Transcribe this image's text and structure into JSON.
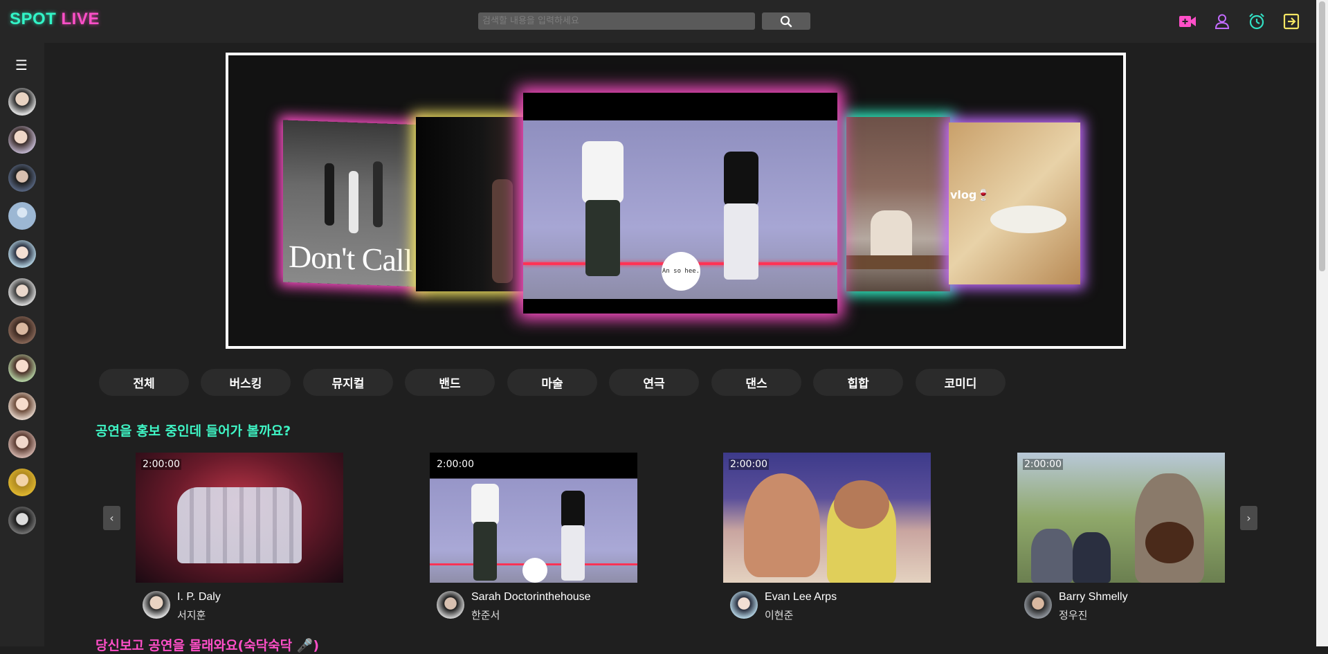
{
  "header": {
    "logo_part1": "SPOT",
    "logo_part2": "LIVE",
    "search_placeholder": "검색할 내용을 입력하세요",
    "icons": [
      "live-camera-icon",
      "user-icon",
      "alarm-clock-icon",
      "logout-icon"
    ],
    "icon_colors": [
      "#ff4fc8",
      "#c46bff",
      "#32e0c4",
      "#f5e663"
    ]
  },
  "sidebar": {
    "menu_icon": "☰",
    "avatars": [
      "avatar-1",
      "avatar-2",
      "avatar-3",
      "avatar-4",
      "avatar-5",
      "avatar-6",
      "avatar-7",
      "avatar-8",
      "avatar-9",
      "avatar-10",
      "avatar-11",
      "avatar-12"
    ]
  },
  "hero": {
    "left_card_caption": "Don't Call Me",
    "center_caption": "An so hee.",
    "right_card_caption": "vlog🍷",
    "glow_colors": [
      "#ff4fc8",
      "#f5e663",
      "#ff4fc8",
      "#32f5c8",
      "#c46bff"
    ]
  },
  "categories": [
    "전체",
    "버스킹",
    "뮤지컬",
    "밴드",
    "마술",
    "연극",
    "댄스",
    "힙합",
    "코미디"
  ],
  "promo_section": {
    "title": "공연을 홍보 중인데 들어가 볼까요?",
    "prev_label": "‹",
    "next_label": "›",
    "videos": [
      {
        "duration": "2:00:00",
        "name": "I. P. Daly",
        "sub": "서지훈"
      },
      {
        "duration": "2:00:00",
        "name": "Sarah Doctorinthehouse",
        "sub": "한준서"
      },
      {
        "duration": "2:00:00",
        "name": "Evan Lee Arps",
        "sub": "이현준"
      },
      {
        "duration": "2:00:00",
        "name": "Barry Shmelly",
        "sub": "정우진"
      }
    ]
  },
  "next_section": {
    "title": "당신보고 공연을 몰래와요(숙닥숙닥 🎤)"
  }
}
